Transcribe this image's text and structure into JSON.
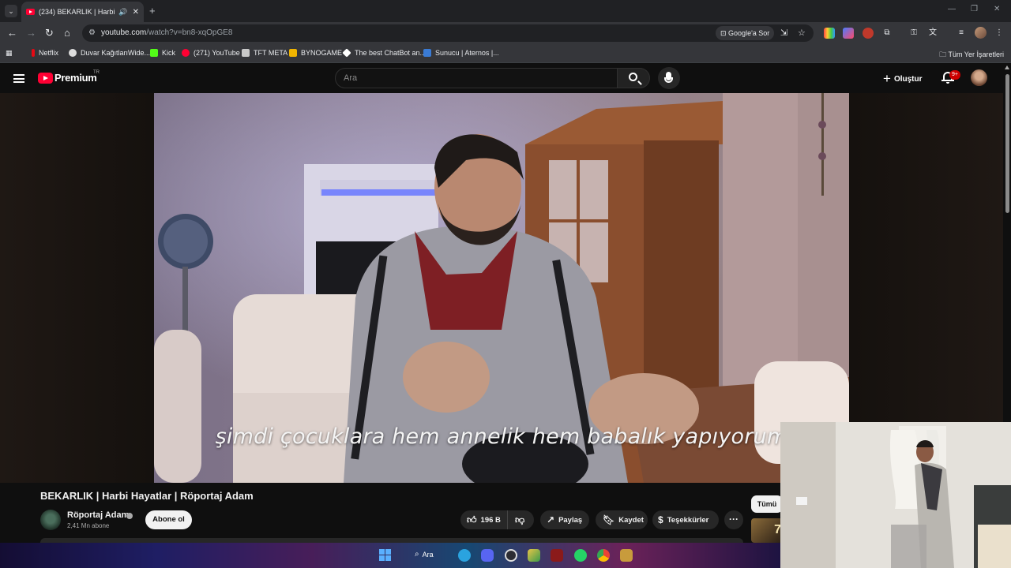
{
  "browser": {
    "tab": {
      "title": "(234) BEKARLIK | Harbi Hayatlar | Röportaj Adam"
    },
    "url": {
      "host": "youtube.com",
      "path": "/watch?v=bn8-xqOpGE8"
    },
    "google_sor": "Google'a Sor",
    "bookmarks": [
      {
        "label": "Netflix",
        "icon": "netflix-icon",
        "color": "#e50914"
      },
      {
        "label": "Duvar KağıtlarıWide...",
        "icon": "wallpaper-icon",
        "color": "#dddddd"
      },
      {
        "label": "Kick",
        "icon": "kick-icon",
        "color": "#53fc18"
      },
      {
        "label": "(271) YouTube",
        "icon": "youtube-icon",
        "color": "#ff0033"
      },
      {
        "label": "TFT META",
        "icon": "tft-icon",
        "color": "#c9c9c9"
      },
      {
        "label": "BYNOGAME",
        "icon": "bynogame-icon",
        "color": "#f0b400"
      },
      {
        "label": "The best ChatBot an...",
        "icon": "chatbot-icon",
        "color": "#ffffff"
      },
      {
        "label": "Sunucu | Aternos |...",
        "icon": "aternos-icon",
        "color": "#3a7bd5"
      }
    ],
    "all_bookmarks": "Tüm Yer İşaretleri"
  },
  "youtube": {
    "brand": "Premium",
    "region": "TR",
    "search_placeholder": "Ara",
    "create_label": "Oluştur",
    "notifications_badge": "9+",
    "subtitle": "şimdi çocuklara hem annelik hem babalık yapıyorum",
    "video_title": "BEKARLIK | Harbi Hayatlar | Röportaj Adam",
    "channel": {
      "name": "Röportaj Adam",
      "subscribers": "2,41 Mn abone"
    },
    "subscribe_label": "Abone ol",
    "likes": "196 B",
    "share_label": "Paylaş",
    "save_label": "Kaydet",
    "thanks_label": "Teşekkürler",
    "chip_all": "Tümü",
    "rec_thumb_text": "7"
  },
  "taskbar": {
    "search_label": "Ara"
  },
  "colors": {
    "accent": "#ff0033",
    "background": "#0f0f0f",
    "chip": "#272727"
  }
}
